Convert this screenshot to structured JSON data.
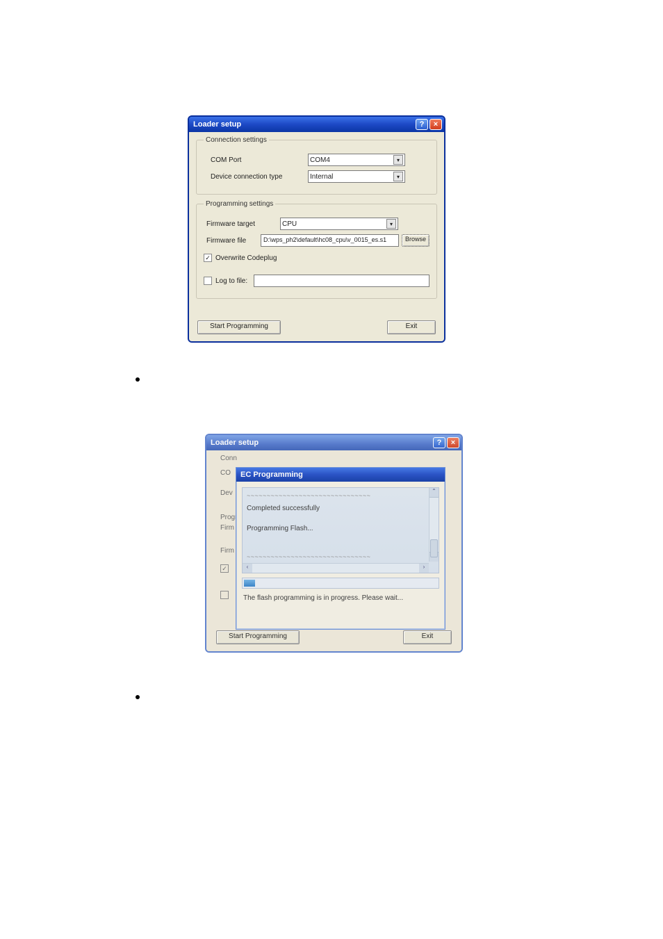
{
  "win1": {
    "title": "Loader setup",
    "conn_group": "Connection settings",
    "com_port_label": "COM Port",
    "com_port_value": "COM4",
    "dev_conn_label": "Device connection type",
    "dev_conn_value": "Internal",
    "prog_group": "Programming settings",
    "fw_target_label": "Firmware target",
    "fw_target_value": "CPU",
    "fw_file_label": "Firmware file",
    "fw_file_value": "D:\\wps_ph2\\default\\hc08_cpu\\v_0015_es.s1",
    "browse_btn": "Browse",
    "overwrite_label": "Overwrite Codeplug",
    "log_label": "Log to file:",
    "start_btn": "Start Programming",
    "exit_btn": "Exit"
  },
  "win2": {
    "title": "Loader setup",
    "conn_prefix": "Conn",
    "com_prefix": "CO",
    "dev_prefix": "Dev",
    "prog_prefix": "Progr",
    "firm1_prefix": "Firm",
    "firm2_prefix": "Firm",
    "dialog_title": "EC Programming",
    "log_line_a": "~~~~~~~~~~~~~~~~~~~~~~~~~~~~~~~",
    "log_msg1": "Completed successfully",
    "log_msg2": "Programming Flash...",
    "log_line_b": "~~~~~~~~~~~~~~~~~~~~~~~~~~~~~~~",
    "status": "The flash programming is in progress. Please wait...",
    "start_btn": "Start Programming",
    "exit_btn": "Exit"
  }
}
